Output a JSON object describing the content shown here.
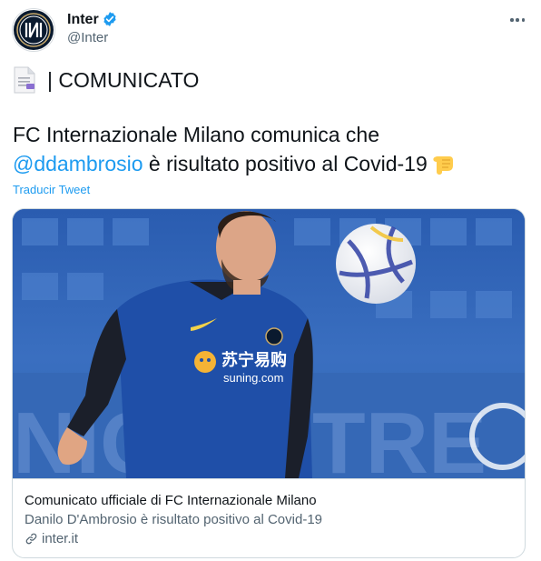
{
  "author": {
    "name": "Inter",
    "handle": "@Inter"
  },
  "tweet": {
    "line1": "| COMUNICATO",
    "line2": "FC Internazionale Milano comunica che",
    "mention": "@ddambrosio",
    "line3_rest": " è risultato positivo al Covid-19",
    "translate": "Traducir Tweet"
  },
  "card": {
    "title": "Comunicato ufficiale di FC Internazionale Milano",
    "description": "Danilo D'Ambrosio è risultato positivo al Covid-19",
    "domain": "inter.it",
    "photo_text": {
      "sponsor_chinese": "苏宁易购",
      "sponsor_domain": "suning.com"
    }
  },
  "icons": {
    "avatar": "inter-logo-icon",
    "verified": "verified-badge-icon",
    "more": "more-options-icon",
    "document": "page-facing-up-icon",
    "pointing": "backhand-index-pointing-down-icon",
    "link": "link-icon"
  },
  "colors": {
    "accent": "#1d9bf0",
    "secondary_text": "#536471",
    "border": "#cfd9de"
  }
}
